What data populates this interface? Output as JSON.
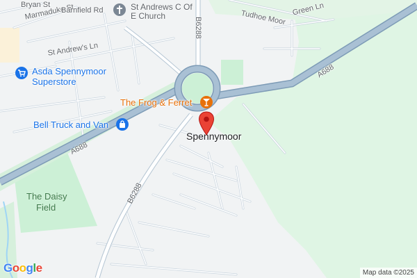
{
  "map": {
    "streets": {
      "bryan_st": "Bryan St",
      "marmaduke_st": "Marmaduke St",
      "barnfield_rd": "Barnfield Rd",
      "st_andrews_ln": "St Andrew's Ln",
      "b6288_top": "B6288",
      "b6288_bottom": "B6288",
      "tudhoe_moor": "Tudhoe Moor",
      "green_ln": "Green Ln",
      "a688_right": "A688",
      "a688_left": "A688"
    },
    "places": {
      "church": "St Andrews C Of E Church",
      "asda_line1": "Asda Spennymoor",
      "asda_line2": "Superstore",
      "frog": "The Frog & Ferret",
      "bell_truck": "Bell Truck and Van",
      "town": "Spennymoor",
      "daisy_line1": "The Daisy",
      "daisy_line2": "Field"
    },
    "icons": {
      "church": "cross-icon",
      "asda": "shopping-cart-icon",
      "frog": "cocktail-icon",
      "bell_truck": "shopping-bag-icon",
      "marker": "map-pin-icon"
    },
    "colors": {
      "land": "#f1f3f4",
      "park": "#ccf0d6",
      "green_area": "#dff5e4",
      "motorway": "#8aa9c4",
      "road": "#ffffff",
      "road_outline": "#b4c5d3",
      "poi_shop": "#1a73e8",
      "poi_food": "#e8710a",
      "poi_church": "#7b8794",
      "marker": "#ea4335"
    },
    "logo": "Google",
    "attribution": "Map data ©2025"
  }
}
